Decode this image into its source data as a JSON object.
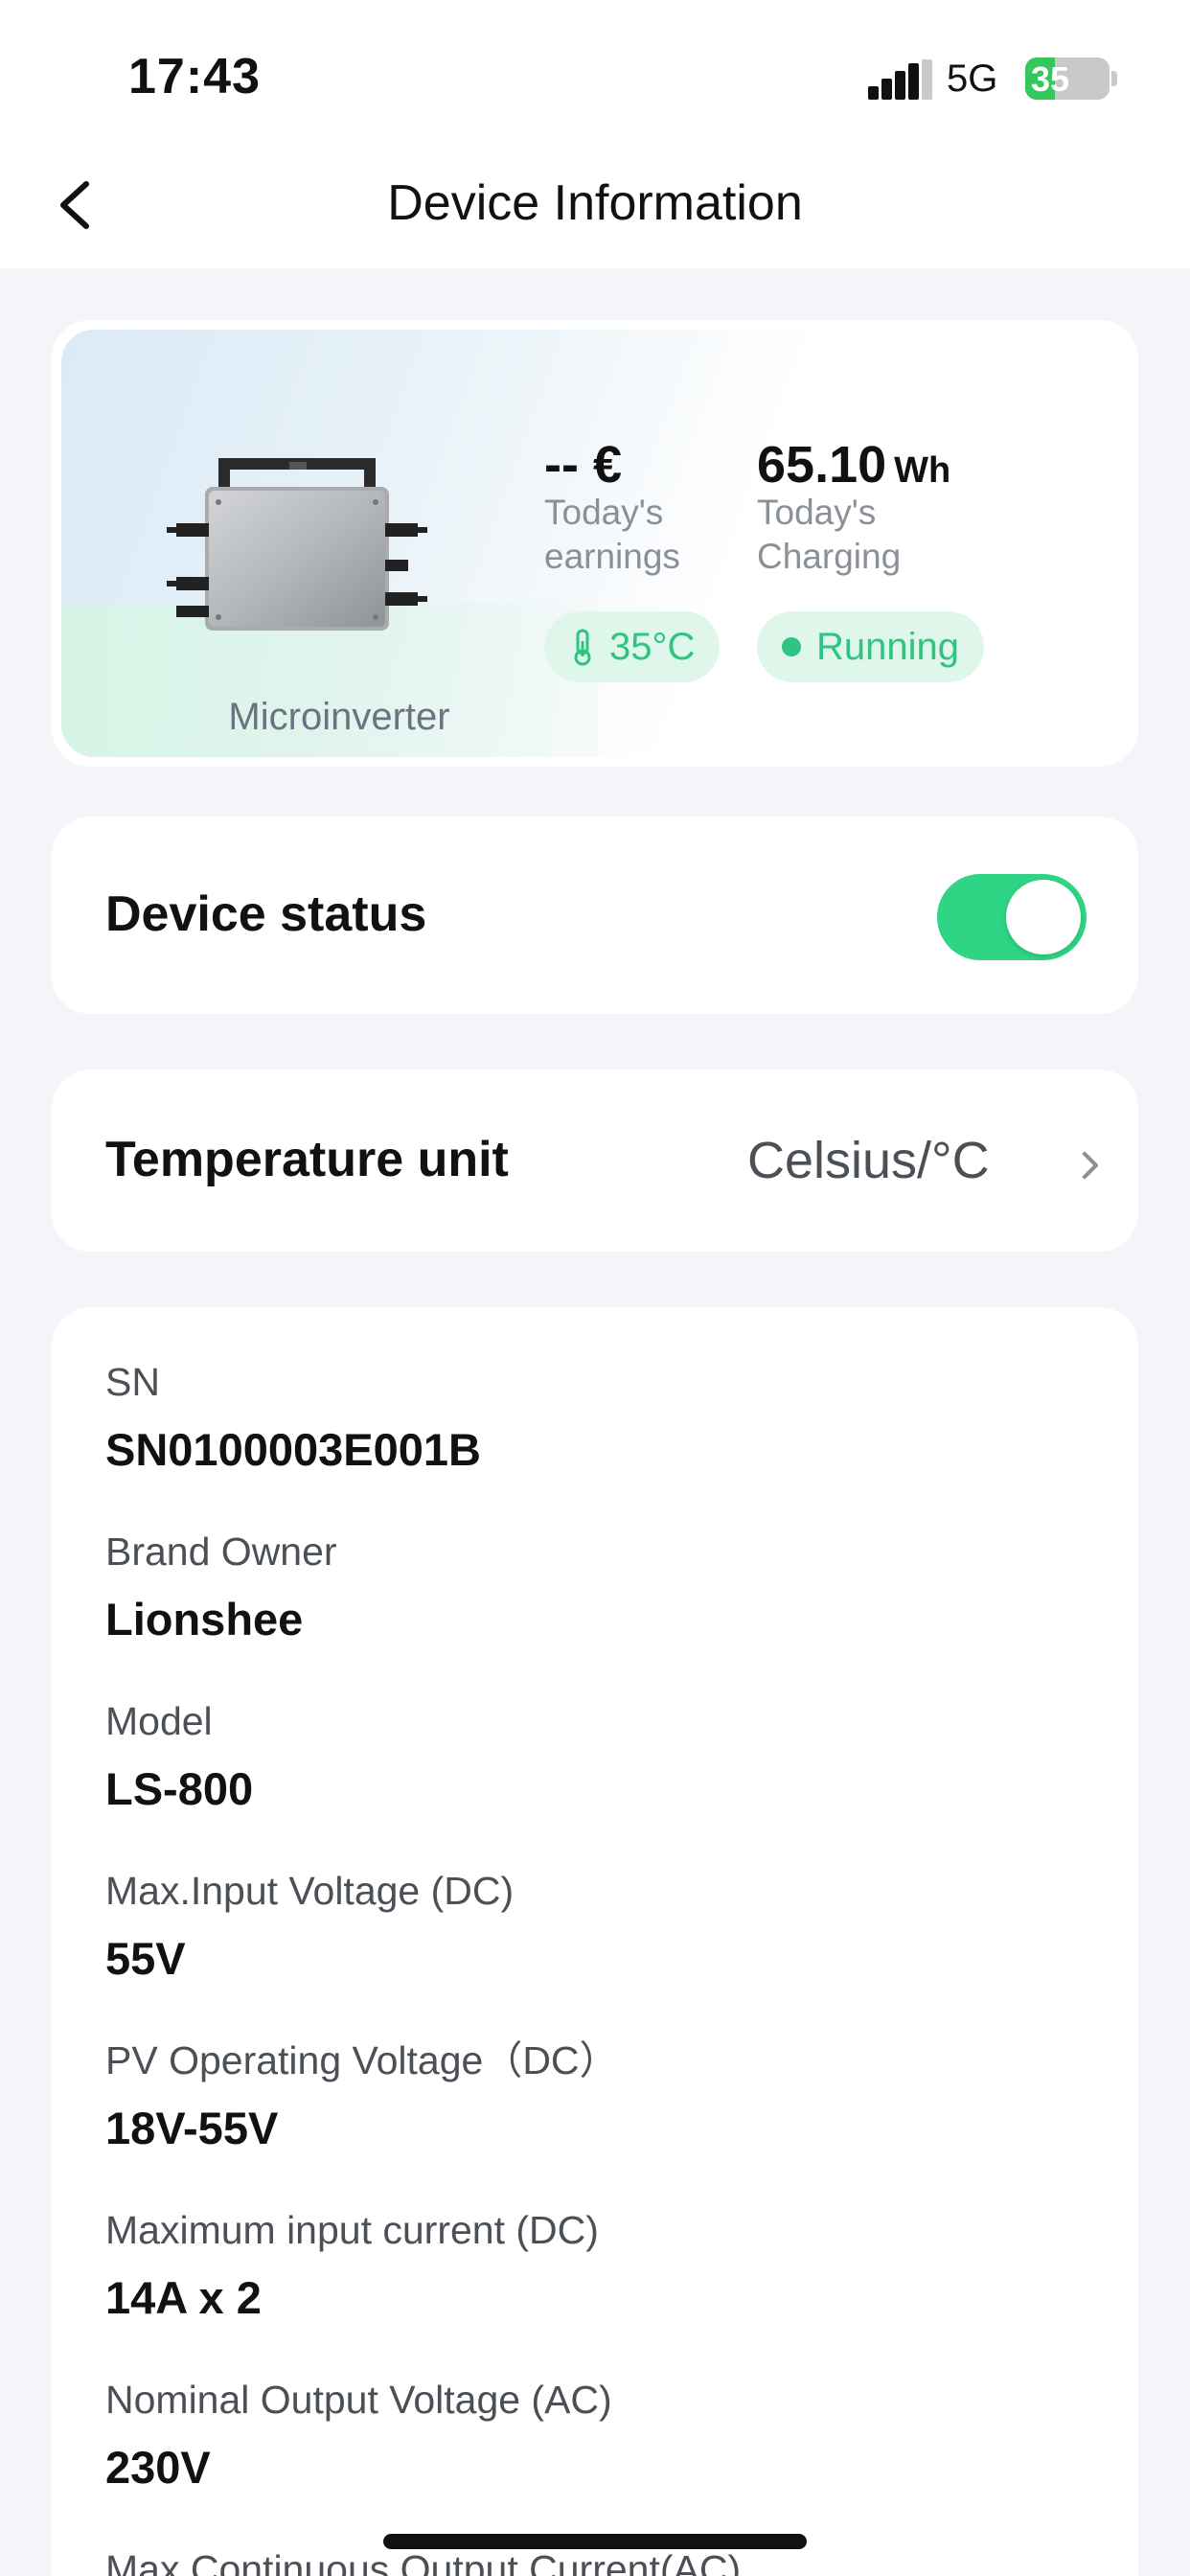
{
  "status_bar": {
    "time": "17:43",
    "network": "5G",
    "battery_level": 35,
    "battery_text": "35"
  },
  "nav": {
    "title": "Device Information",
    "back_icon": "chevron-left-icon"
  },
  "hero": {
    "device_label": "Microinverter",
    "earnings_value": "-- €",
    "earnings_label": "Today's earnings",
    "charging_value": "65.10",
    "charging_unit": "Wh",
    "charging_label": "Today's Charging",
    "temperature_pill": "35°C",
    "state_pill": "Running",
    "accent_color": "#2fc481"
  },
  "device_status": {
    "label": "Device status",
    "enabled": true,
    "toggle_color": "#2fd484"
  },
  "temperature_unit": {
    "label": "Temperature unit",
    "value": "Celsius/°C"
  },
  "info": [
    {
      "label": "SN",
      "value": "SN0100003E001B"
    },
    {
      "label": "Brand Owner",
      "value": "Lionshee"
    },
    {
      "label": "Model",
      "value": "LS-800"
    },
    {
      "label": "Max.Input Voltage (DC)",
      "value": "55V"
    },
    {
      "label": "PV Operating Voltage（DC）",
      "value": "18V-55V"
    },
    {
      "label": "Maximum input current (DC)",
      "value": "14A x 2"
    },
    {
      "label": "Nominal Output Voltage (AC)",
      "value": "230V"
    },
    {
      "label": "Max.Continuous Output Current(AC)",
      "value": ""
    }
  ]
}
